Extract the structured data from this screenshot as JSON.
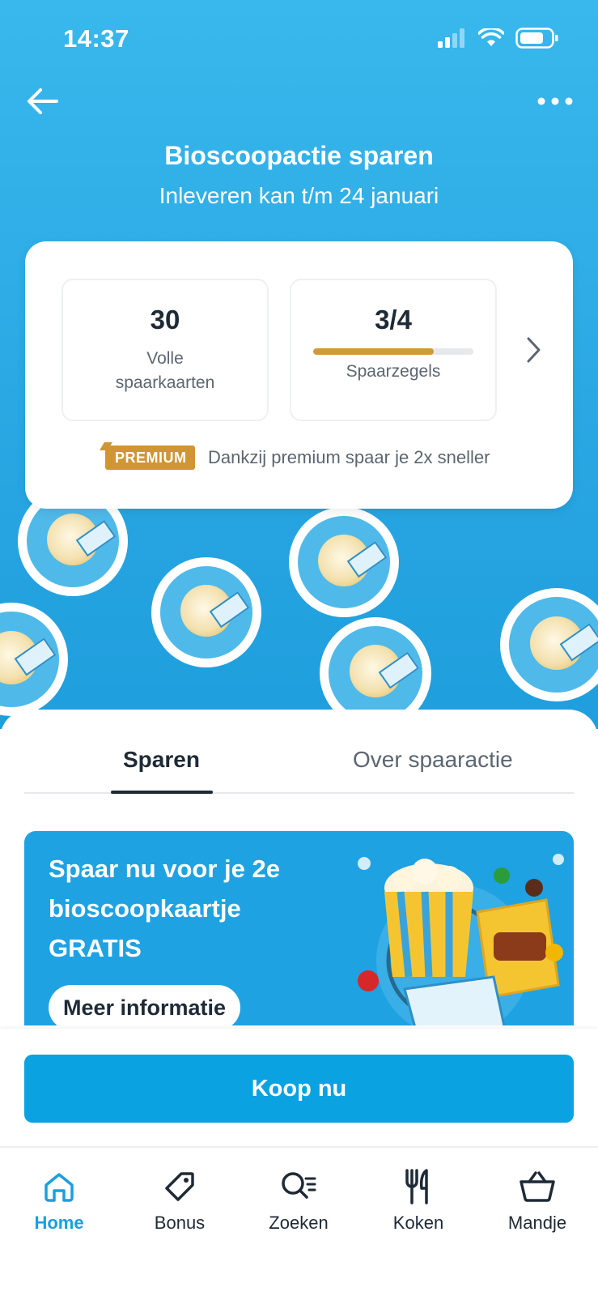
{
  "status_bar": {
    "time": "14:37"
  },
  "header": {
    "title": "Bioscoopactie sparen",
    "subtitle": "Inleveren kan t/m 24 januari"
  },
  "summary": {
    "full_cards_value": "30",
    "full_cards_label": "Volle spaarkaarten",
    "stamps_value": "3/4",
    "stamps_progress": 0.75,
    "stamps_label": "Spaarzegels",
    "premium_badge": "PREMIUM",
    "premium_text": "Dankzij premium spaar je 2x sneller",
    "accent_color": "#d19a38"
  },
  "decor": {
    "stamp_text": "Bioscoopzegel"
  },
  "tabs": [
    {
      "label": "Sparen",
      "active": true
    },
    {
      "label": "Over spaaractie",
      "active": false
    }
  ],
  "promo": {
    "headline": "Spaar nu voor je 2e bioscoopkaartje GRATIS",
    "button": "Meer informatie"
  },
  "buy": {
    "label": "Koop nu"
  },
  "tabbar": [
    {
      "label": "Home",
      "icon": "home-icon",
      "active": true
    },
    {
      "label": "Bonus",
      "icon": "tag-icon",
      "active": false
    },
    {
      "label": "Zoeken",
      "icon": "search-icon",
      "active": false
    },
    {
      "label": "Koken",
      "icon": "cutlery-icon",
      "active": false
    },
    {
      "label": "Mandje",
      "icon": "basket-icon",
      "active": false
    }
  ],
  "colors": {
    "primary": "#0aa2e0",
    "hero": "#2aa8e4",
    "text_dark": "#1e2a36"
  }
}
